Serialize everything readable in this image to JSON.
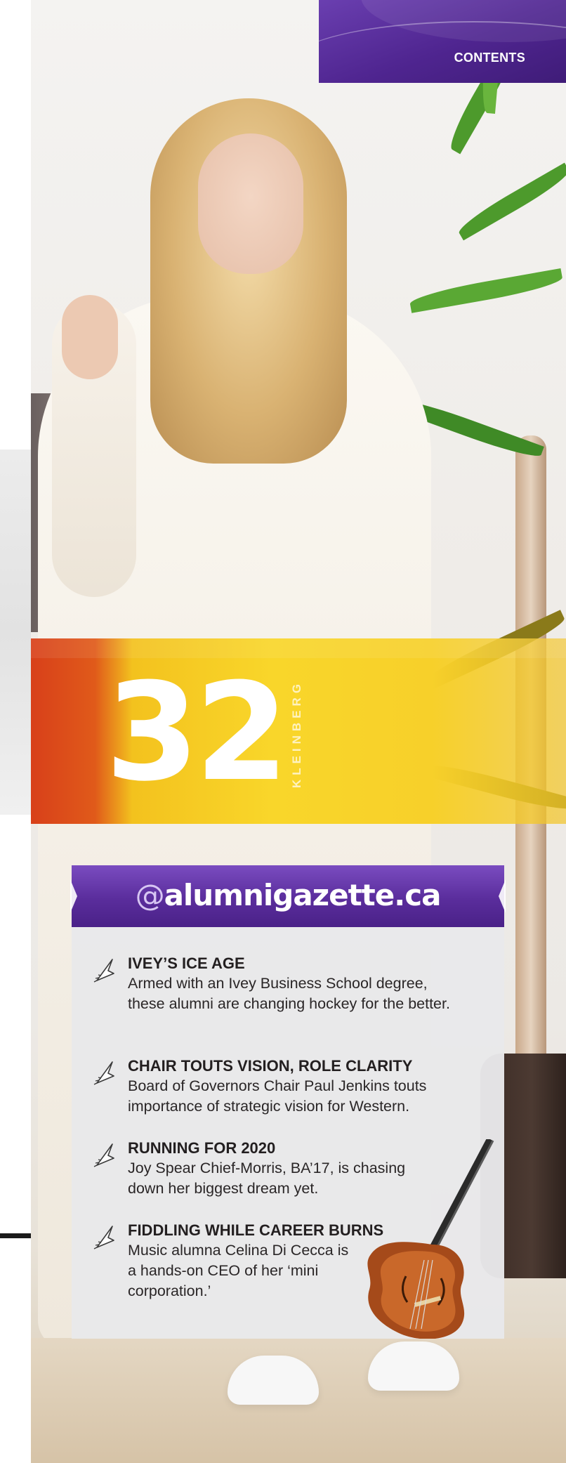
{
  "header": {
    "contents_label": "CONTENTS"
  },
  "feature": {
    "page_number": "32",
    "subject_name": "KLEINBERG"
  },
  "gazette": {
    "url_at": "@",
    "url_domain": "alumnigazette.ca",
    "stories": [
      {
        "icon": "cursor-icon",
        "headline": "IVEY’S ICE AGE",
        "blurb": "Armed with an Ivey Business School degree, these alumni are changing hockey for the better."
      },
      {
        "icon": "cursor-icon",
        "headline": "CHAIR TOUTS VISION, ROLE CLARITY",
        "blurb": "Board of Governors Chair Paul Jenkins touts importance of strategic vision for Western."
      },
      {
        "icon": "cursor-icon",
        "headline": "RUNNING FOR 2020",
        "blurb": "Joy Spear Chief-Morris, BA’17, is chasing down her biggest dream yet."
      },
      {
        "icon": "cursor-icon",
        "headline": "FIDDLING WHILE CAREER BURNS",
        "blurb": "Music alumna Celina Di Cecca is a hands-on CEO of her ‘mini corporation.’"
      }
    ]
  },
  "colors": {
    "purple": "#4f2590",
    "yellow": "#f9d62a",
    "orange": "#d8401a"
  }
}
